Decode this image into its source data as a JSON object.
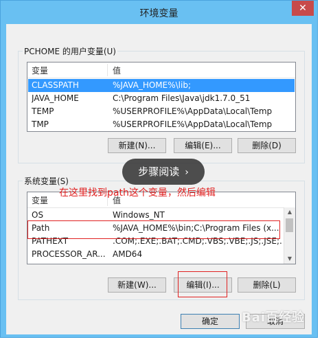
{
  "window": {
    "title": "环境变量",
    "close_glyph": "✕"
  },
  "user_vars": {
    "label": "PCHOME 的用户变量(U)",
    "col_variable": "变量",
    "col_value": "值",
    "rows": [
      {
        "name": "CLASSPATH",
        "value": "%JAVA_HOME%\\lib;"
      },
      {
        "name": "JAVA_HOME",
        "value": "C:\\Program Files\\Java\\jdk1.7.0_51"
      },
      {
        "name": "TEMP",
        "value": "%USERPROFILE%\\AppData\\Local\\Temp"
      },
      {
        "name": "TMP",
        "value": "%USERPROFILE%\\AppData\\Local\\Temp"
      }
    ],
    "new_label": "新建(N)...",
    "edit_label": "编辑(E)...",
    "delete_label": "删除(D)"
  },
  "system_vars": {
    "label": "系统变量(S)",
    "col_variable": "变量",
    "col_value": "值",
    "rows": [
      {
        "name": "OS",
        "value": "Windows_NT"
      },
      {
        "name": "Path",
        "value": "%JAVA_HOME%\\bin;C:\\Program Files (x..."
      },
      {
        "name": "PATHEXT",
        "value": ".COM;.EXE;.BAT;.CMD;.VBS;.VBE;.JS;.JSE;..."
      },
      {
        "name": "PROCESSOR_AR...",
        "value": "AMD64"
      }
    ],
    "new_label": "新建(W)...",
    "edit_label": "编辑(I)...",
    "delete_label": "删除(L)"
  },
  "dialog": {
    "ok_label": "确定",
    "cancel_label": "取消"
  },
  "overlay": {
    "text": "步骤阅读",
    "chevron": "›"
  },
  "annotation": {
    "text": "在这里找到path这个变量，然后编辑"
  },
  "watermark": {
    "text": "Bai百经验"
  },
  "colors": {
    "accent": "#69c0f2",
    "selection": "#3399ff",
    "annotation_red": "#e02020",
    "close_red": "#c74a4a"
  }
}
